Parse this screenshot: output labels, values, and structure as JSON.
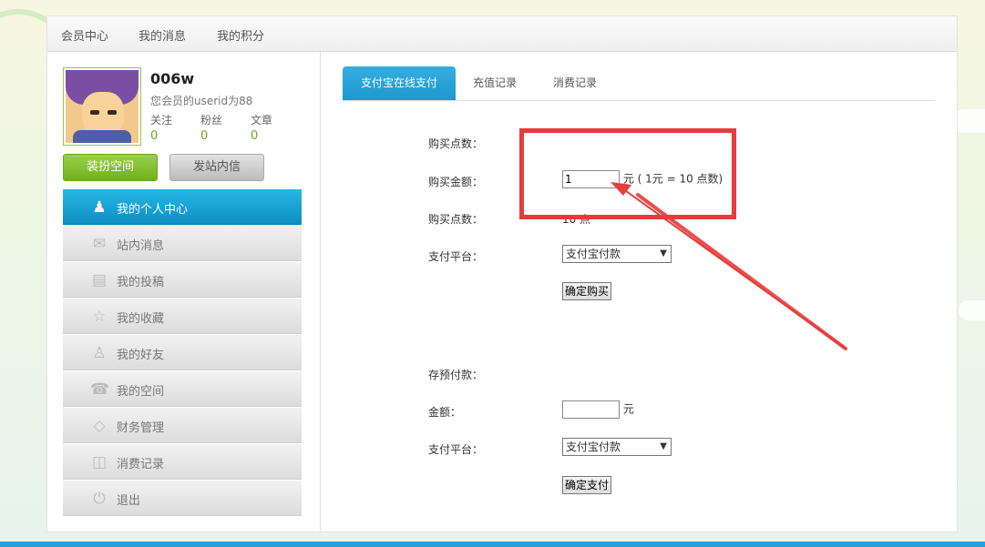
{
  "nav": {
    "items": [
      "会员中心",
      "我的消息",
      "我的积分"
    ]
  },
  "profile": {
    "username": "006w",
    "userid_text": "您会员的userid为88",
    "stats": [
      {
        "label": "关注",
        "value": "0"
      },
      {
        "label": "粉丝",
        "value": "0"
      },
      {
        "label": "文章",
        "value": "0"
      }
    ],
    "btn_decorate": "装扮空间",
    "btn_message": "发站内信"
  },
  "menu": {
    "items": [
      {
        "label": "我的个人中心",
        "icon": "user-icon"
      },
      {
        "label": "站内消息",
        "icon": "message-icon"
      },
      {
        "label": "我的投稿",
        "icon": "document-icon"
      },
      {
        "label": "我的收藏",
        "icon": "star-icon"
      },
      {
        "label": "我的好友",
        "icon": "friends-icon"
      },
      {
        "label": "我的空间",
        "icon": "space-icon"
      },
      {
        "label": "财务管理",
        "icon": "diamond-icon"
      },
      {
        "label": "消费记录",
        "icon": "cart-icon"
      },
      {
        "label": "退出",
        "icon": "power-icon"
      }
    ]
  },
  "tabs": [
    "支付宝在线支付",
    "充值记录",
    "消费记录"
  ],
  "buy": {
    "label_points_header": "购买点数：",
    "label_amount": "购买金额：",
    "amount_value": "1",
    "amount_unit_note": "元 ( 1元 = 10 点数)",
    "label_points": "购买点数：",
    "points_value": "10 点",
    "label_platform": "支付平台：",
    "platform_value": "支付宝付款",
    "confirm_button": "确定购买"
  },
  "deposit": {
    "label_header": "存预付款：",
    "label_amount": "金额：",
    "amount_value": "",
    "amount_unit": "元",
    "label_platform": "支付平台：",
    "platform_value": "支付宝付款",
    "confirm_button": "确定支付"
  },
  "colors": {
    "accent_blue": "#1e97cf",
    "green": "#6fb11e",
    "highlight_red": "#e83b3b"
  }
}
